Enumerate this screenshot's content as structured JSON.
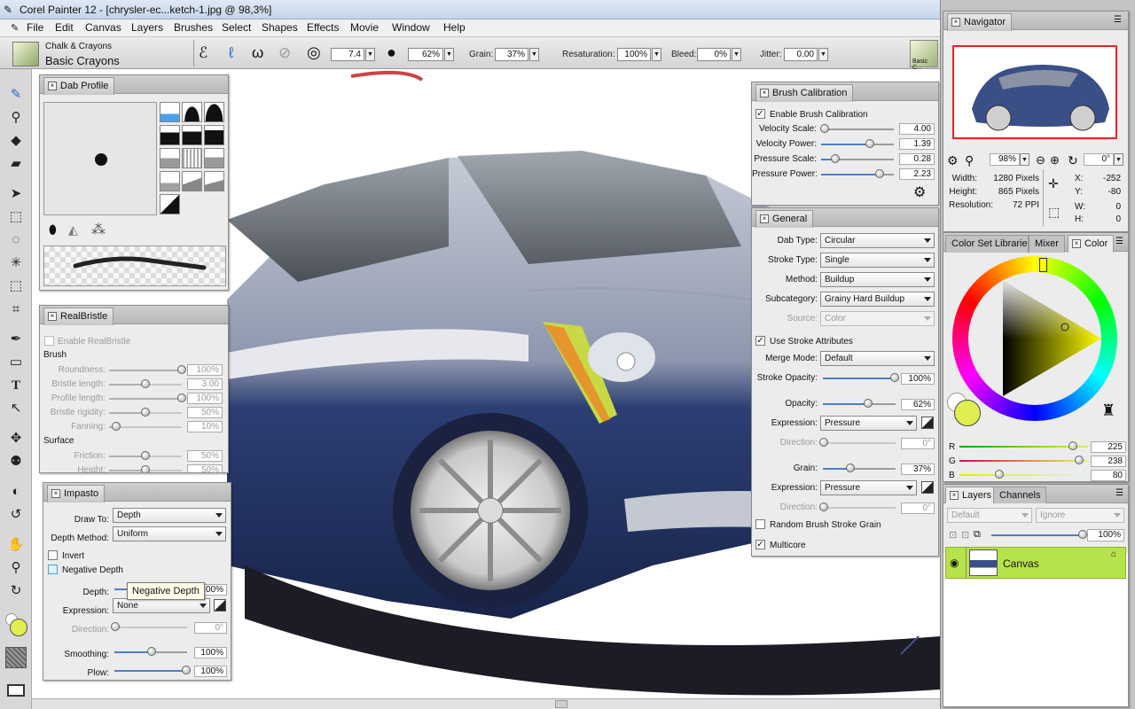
{
  "window": {
    "title": "Corel Painter 12 - [chrysler-ec...ketch-1.jpg @ 98,3%]"
  },
  "menu": [
    "File",
    "Edit",
    "Canvas",
    "Layers",
    "Brushes",
    "Select",
    "Shapes",
    "Effects",
    "Movie",
    "Window",
    "Help"
  ],
  "brush": {
    "category": "Chalk & Crayons",
    "variant": "Basic Crayons",
    "variant_short": "Basic C..."
  },
  "propbar": {
    "size": "7.4",
    "opacity": "62%",
    "grain_label": "Grain:",
    "grain": "37%",
    "resaturation_label": "Resaturation:",
    "resaturation": "100%",
    "bleed_label": "Bleed:",
    "bleed": "0%",
    "jitter_label": "Jitter:",
    "jitter": "0.00"
  },
  "dab_profile": {
    "title": "Dab Profile"
  },
  "realbristle": {
    "title": "RealBristle",
    "enable": "Enable RealBristle",
    "brush_heading": "Brush",
    "rows": [
      {
        "label": "Roundness:",
        "value": "100%",
        "pct": 1.0
      },
      {
        "label": "Bristle length:",
        "value": "3.00",
        "pct": 0.5
      },
      {
        "label": "Profile length:",
        "value": "100%",
        "pct": 1.0
      },
      {
        "label": "Bristle rigidity:",
        "value": "50%",
        "pct": 0.5
      },
      {
        "label": "Fanning:",
        "value": "10%",
        "pct": 0.1
      }
    ],
    "surface_heading": "Surface",
    "surface_rows": [
      {
        "label": "Friction:",
        "value": "50%",
        "pct": 0.5
      },
      {
        "label": "Height:",
        "value": "50%",
        "pct": 0.5
      }
    ]
  },
  "impasto": {
    "title": "Impasto",
    "draw_to_label": "Draw To:",
    "draw_to": "Depth",
    "depth_method_label": "Depth Method:",
    "depth_method": "Uniform",
    "invert": "Invert",
    "negative_depth": "Negative Depth",
    "depth_label": "Depth:",
    "depth_value": "100%",
    "tooltip": "Negative Depth",
    "expression_label": "Expression:",
    "expression": "None",
    "direction_label": "Direction:",
    "direction": "0°",
    "smoothing_label": "Smoothing:",
    "smoothing": "100%",
    "plow_label": "Plow:",
    "plow": "100%"
  },
  "calibration": {
    "title": "Brush Calibration",
    "enable": "Enable Brush Calibration",
    "rows": [
      {
        "label": "Velocity Scale:",
        "value": "4.00",
        "pct": 0.05
      },
      {
        "label": "Velocity Power:",
        "value": "1.39",
        "pct": 0.67
      },
      {
        "label": "Pressure Scale:",
        "value": "0.28",
        "pct": 0.2
      },
      {
        "label": "Pressure Power:",
        "value": "2.23",
        "pct": 0.8
      }
    ]
  },
  "general": {
    "title": "General",
    "dab_type_label": "Dab Type:",
    "dab_type": "Circular",
    "stroke_type_label": "Stroke Type:",
    "stroke_type": "Single",
    "method_label": "Method:",
    "method": "Buildup",
    "subcategory_label": "Subcategory:",
    "subcategory": "Grainy Hard Buildup",
    "source_label": "Source:",
    "source": "Color",
    "use_stroke": "Use Stroke Attributes",
    "merge_label": "Merge Mode:",
    "merge": "Default",
    "stroke_opacity_label": "Stroke Opacity:",
    "stroke_opacity": "100%",
    "opacity_label": "Opacity:",
    "opacity": "62%",
    "expression_label": "Expression:",
    "expression": "Pressure",
    "direction_label": "Direction:",
    "direction": "0°",
    "grain_label": "Grain:",
    "grain": "37%",
    "grain_expression": "Pressure",
    "grain_direction": "0°",
    "random_grain": "Random Brush Stroke Grain",
    "multicore": "Multicore"
  },
  "navigator": {
    "title": "Navigator",
    "zoom": "98%",
    "rotation": "0°",
    "width_label": "Width:",
    "width": "1280 Pixels",
    "height_label": "Height:",
    "height": "865 Pixels",
    "resolution_label": "Resolution:",
    "resolution": "72 PPI",
    "x_label": "X:",
    "x": "-252",
    "y_label": "Y:",
    "y": "-80",
    "w_label": "W:",
    "w": "0",
    "h_label": "H:",
    "h": "0"
  },
  "color_tabs": [
    "Color Set Libraries",
    "Mixer",
    "Color"
  ],
  "color": {
    "r_label": "R",
    "r": "225",
    "g_label": "G",
    "g": "238",
    "b_label": "B",
    "b": "80",
    "r_pct": 0.88,
    "g_pct": 0.93,
    "b_pct": 0.31,
    "main_hex": "#e1ee50"
  },
  "layers": {
    "tabs": [
      "Layers",
      "Channels"
    ],
    "composite": "Default",
    "depth": "Ignore",
    "opacity": "100%",
    "layer_name": "Canvas"
  },
  "colors": {
    "accent": "#b7e34a",
    "selection": "#4d7fc6"
  }
}
